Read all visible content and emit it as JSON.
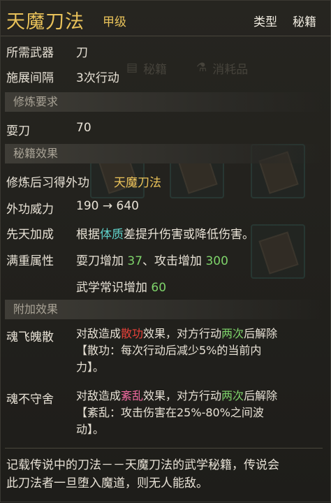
{
  "header": {
    "title": "天魔刀法",
    "grade": "甲级",
    "type_label": "类型",
    "type_value": "秘籍"
  },
  "background_tabs": [
    "秘籍",
    "消耗品"
  ],
  "weapon": {
    "label": "所需武器",
    "value": "刀"
  },
  "interval": {
    "label": "施展间隔",
    "value": "3次行动"
  },
  "sections": {
    "requirement": "修炼要求",
    "effect": "秘籍效果",
    "extra": "附加效果"
  },
  "requirement": {
    "label": "耍刀",
    "value": "70"
  },
  "learn": {
    "label": "修炼后习得外功",
    "value": "天魔刀法"
  },
  "power": {
    "label": "外功威力",
    "from": "190",
    "arrow": "→",
    "to": "640"
  },
  "innate": {
    "label": "先天加成",
    "pre": "根据",
    "attr": "体质",
    "post": "差提升伤害或降低伤害。"
  },
  "full": {
    "label": "满重属性",
    "line1_a": "耍刀增加 ",
    "line1_b": "37",
    "line1_c": "、攻击增加 ",
    "line1_d": "300",
    "line2_a": "武学常识增加 ",
    "line2_b": "60"
  },
  "extra1": {
    "name": "魂飞魄散",
    "l1a": "对敌造成",
    "l1b": "散功",
    "l1c": "效果，对方行动",
    "l1d": "两次",
    "l1e": "后解除",
    "l2": "【散功：每次行动后减少5%的当前内",
    "l3": "力】。"
  },
  "extra2": {
    "name": "魂不守舍",
    "l1a": "对敌造成",
    "l1b": "紊乱",
    "l1c": "效果，对方行动",
    "l1d": "两次",
    "l1e": "后解除",
    "l2": "【紊乱：攻击伤害在25%-80%之间波",
    "l3": "动】。"
  },
  "footer": {
    "line1": "记载传说中的刀法－－天魔刀法的武学秘籍，传说会",
    "line2": "此刀法者一旦堕入魔道，则无人能敌。"
  },
  "colors": {
    "gold": "#e9c25a",
    "green": "#7ed36a",
    "cyan": "#5fd0c8",
    "red": "#e8423a",
    "pink": "#f06aa0"
  },
  "icons": [
    "book-icon",
    "potion-icon"
  ]
}
